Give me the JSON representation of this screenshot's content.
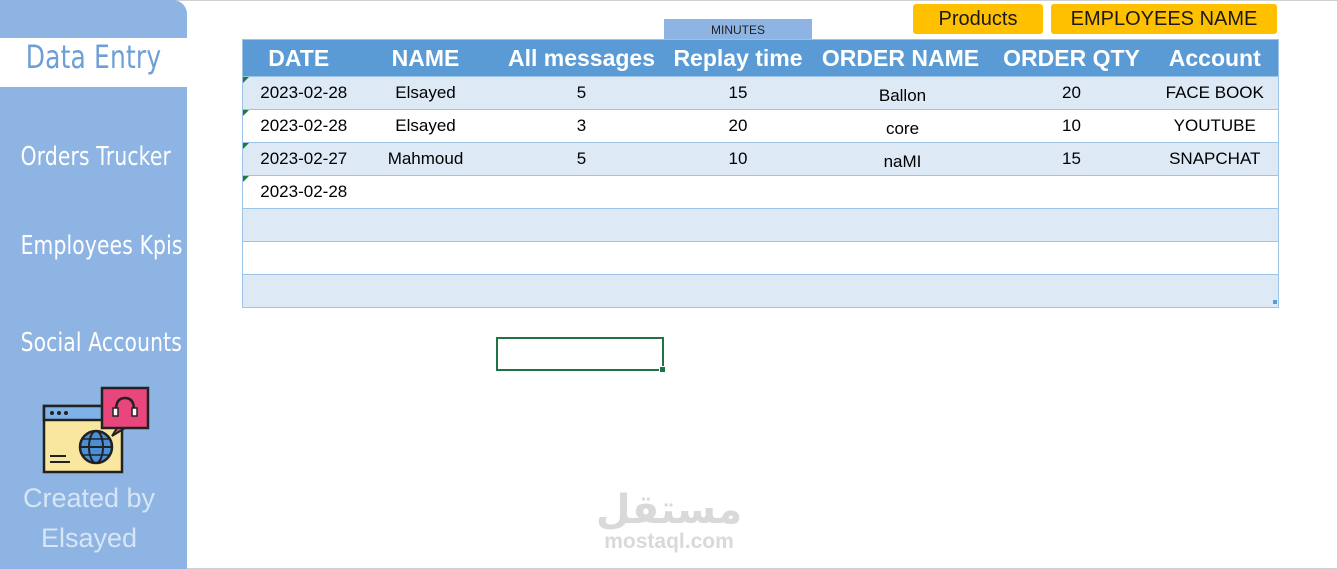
{
  "sidebar": {
    "active_item": "Data Entry",
    "items": [
      "Orders Trucker",
      "Employees Kpis",
      "Social Accounts"
    ],
    "created_by": [
      "Created by",
      "Elsayed"
    ]
  },
  "top_buttons": {
    "products": "Products",
    "employees_name": "EMPLOYEES NAME"
  },
  "minutes_label": "MINUTES",
  "table": {
    "headers": [
      "DATE",
      "NAME",
      "All messages",
      "Replay time",
      "ORDER NAME",
      "ORDER QTY",
      "Account"
    ],
    "rows": [
      [
        "2023-02-28",
        "Elsayed",
        "5",
        "15",
        "Ballon",
        "20",
        "FACE BOOK"
      ],
      [
        "2023-02-28",
        "Elsayed",
        "3",
        "20",
        "core",
        "10",
        "YOUTUBE"
      ],
      [
        "2023-02-27",
        "Mahmoud",
        "5",
        "10",
        "naMI",
        "15",
        "SNAPCHAT"
      ],
      [
        "2023-02-28",
        "",
        "",
        "",
        "",
        "",
        ""
      ],
      [
        "",
        "",
        "",
        "",
        "",
        "",
        ""
      ],
      [
        "",
        "",
        "",
        "",
        "",
        "",
        ""
      ],
      [
        "",
        "",
        "",
        "",
        "",
        "",
        ""
      ]
    ]
  },
  "watermark": {
    "arabic": "مستقل",
    "latin": "mostaql.com"
  },
  "colors": {
    "sidebar": "#8eb4e3",
    "header": "#5b9bd5",
    "band": "#dde9f5",
    "button": "#ffc000",
    "selection": "#217346"
  }
}
